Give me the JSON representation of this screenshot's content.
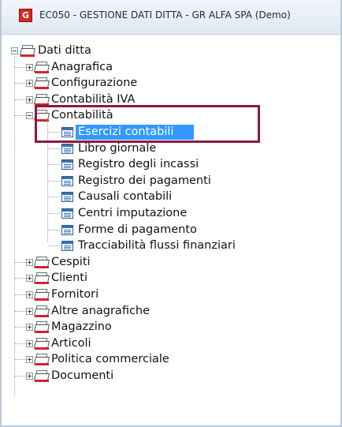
{
  "window": {
    "title": "EC050 - GESTIONE DATI DITTA - GR ALFA SPA  (Demo)",
    "app_icon": "app-logo-icon",
    "app_icon_glyph": "G"
  },
  "tree": {
    "root": {
      "label": "Dati ditta",
      "expanded": true
    },
    "groups": [
      {
        "label": "Anagrafica",
        "expanded": false
      },
      {
        "label": "Configurazione",
        "expanded": false
      },
      {
        "label": "Contabilità IVA",
        "expanded": false
      },
      {
        "label": "Contabilità",
        "expanded": true,
        "children": [
          {
            "label": "Esercizi contabili",
            "selected": true
          },
          {
            "label": "Libro giornale"
          },
          {
            "label": "Registro degli incassi"
          },
          {
            "label": "Registro dei pagamenti"
          },
          {
            "label": "Causali contabili"
          },
          {
            "label": "Centri imputazione"
          },
          {
            "label": "Forme di pagamento"
          },
          {
            "label": "Tracciabilità flussi finanziari"
          }
        ]
      },
      {
        "label": "Cespiti",
        "expanded": false
      },
      {
        "label": "Clienti",
        "expanded": false
      },
      {
        "label": "Fornitori",
        "expanded": false
      },
      {
        "label": "Altre anagrafiche",
        "expanded": false
      },
      {
        "label": "Magazzino",
        "expanded": false
      },
      {
        "label": "Articoli",
        "expanded": false
      },
      {
        "label": "Politica commerciale",
        "expanded": false
      },
      {
        "label": "Documenti",
        "expanded": false
      }
    ]
  },
  "colors": {
    "selection": "#3399ff",
    "highlight_border": "#8b1a3e",
    "folder_accent": "#d0262a"
  }
}
